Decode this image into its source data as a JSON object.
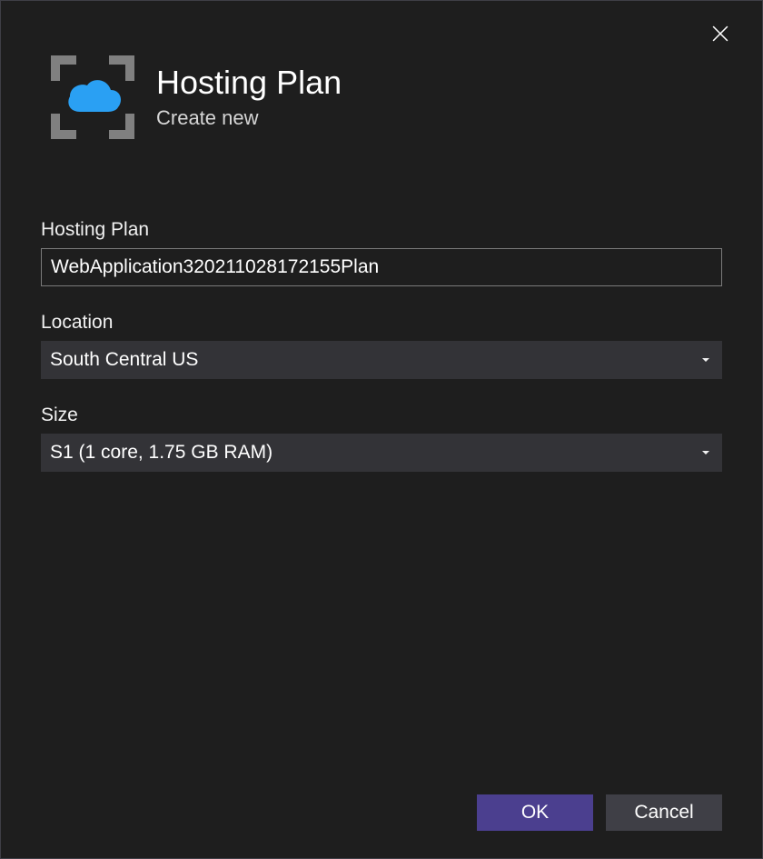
{
  "header": {
    "title": "Hosting Plan",
    "subtitle": "Create new"
  },
  "fields": {
    "hosting_plan": {
      "label": "Hosting Plan",
      "value": "WebApplication320211028172155Plan"
    },
    "location": {
      "label": "Location",
      "value": "South Central US"
    },
    "size": {
      "label": "Size",
      "value": "S1 (1 core, 1.75 GB RAM)"
    }
  },
  "buttons": {
    "ok": "OK",
    "cancel": "Cancel"
  }
}
